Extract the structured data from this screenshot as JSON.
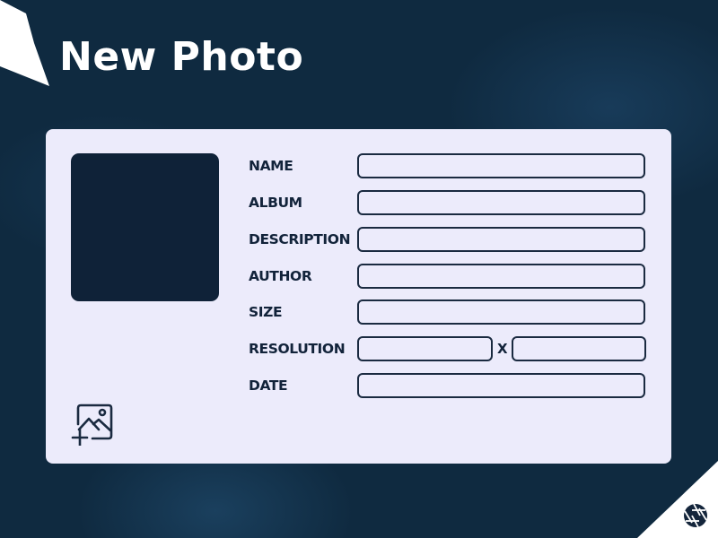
{
  "header": {
    "title": "New Photo"
  },
  "form": {
    "fields": {
      "name": {
        "label": "NAME",
        "value": ""
      },
      "album": {
        "label": "ALBUM",
        "value": ""
      },
      "description": {
        "label": "DESCRIPTION",
        "value": ""
      },
      "author": {
        "label": "AUTHOR",
        "value": ""
      },
      "size": {
        "label": "SIZE",
        "value": ""
      },
      "resolution": {
        "label": "RESOLUTION",
        "width_value": "",
        "height_value": "",
        "separator": "X"
      },
      "date": {
        "label": "DATE",
        "value": ""
      }
    }
  },
  "icons": {
    "add_image": "add-image-icon",
    "camera_shutter": "camera-shutter-icon",
    "ribbon": "ribbon-banner"
  },
  "colors": {
    "background": "#0f2a40",
    "card": "#ecebfb",
    "thumbnail": "#0f2238",
    "text": "#12233a",
    "accent_white": "#ffffff"
  }
}
